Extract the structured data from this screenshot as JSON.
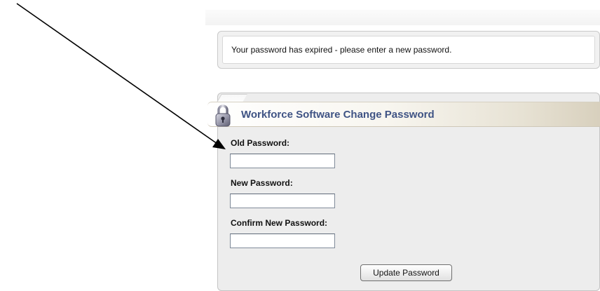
{
  "message": {
    "text": "Your password has expired - please enter a new password."
  },
  "panel": {
    "title": "Workforce Software Change Password",
    "icon": "padlock-icon"
  },
  "fields": [
    {
      "label": "Old Password:",
      "value": "",
      "placeholder": ""
    },
    {
      "label": "New Password:",
      "value": "",
      "placeholder": ""
    },
    {
      "label": "Confirm New Password:",
      "value": "",
      "placeholder": ""
    }
  ],
  "submit": {
    "label": "Update Password"
  },
  "annotation": {
    "icon": "pointer-arrow",
    "color": "#000000"
  },
  "colors": {
    "title_text": "#3f5384",
    "panel_bg": "#ededed",
    "border": "#c4c4c4"
  }
}
